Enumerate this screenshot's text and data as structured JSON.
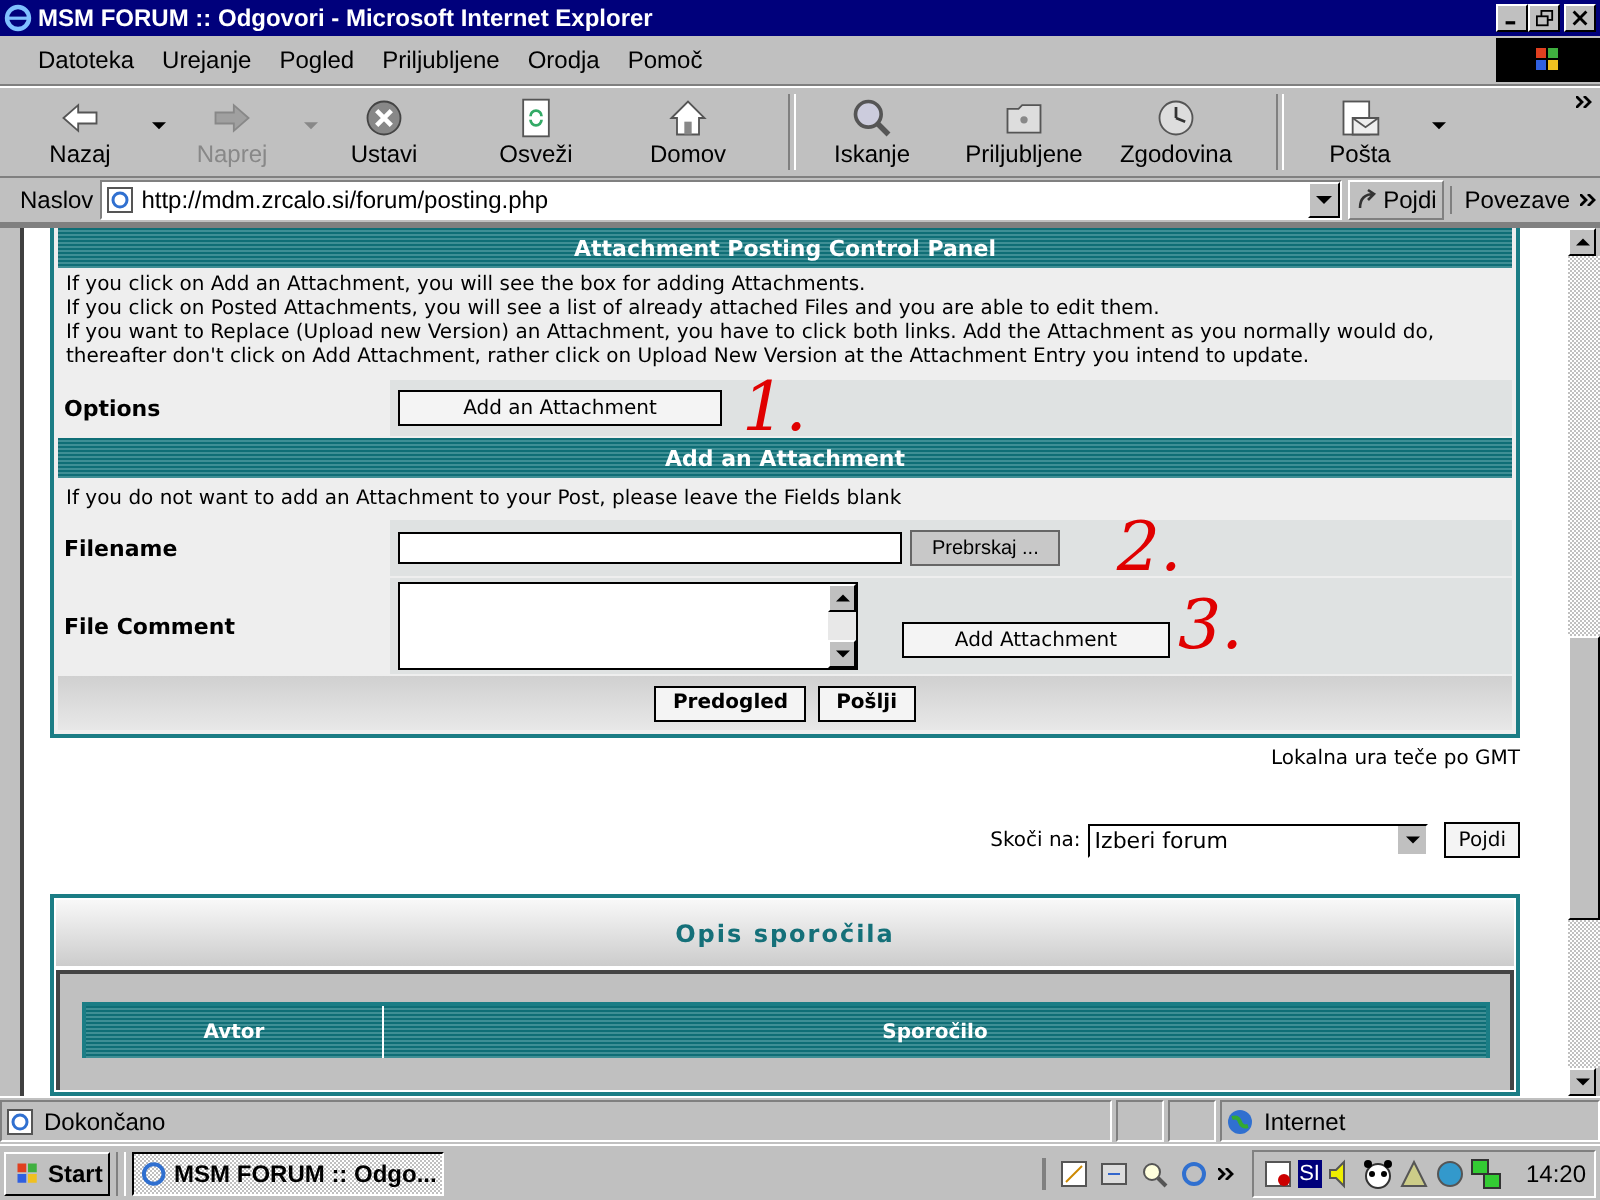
{
  "window": {
    "title": "MSM FORUM :: Odgovori - Microsoft Internet Explorer"
  },
  "menu": [
    "Datoteka",
    "Urejanje",
    "Pogled",
    "Priljubljene",
    "Orodja",
    "Pomoč"
  ],
  "toolbar": [
    {
      "label": "Nazaj",
      "kind": "back",
      "disabled": false,
      "dropdown": true,
      "separator_before": false
    },
    {
      "label": "Naprej",
      "kind": "forward",
      "disabled": true,
      "dropdown": true,
      "separator_before": false
    },
    {
      "label": "Ustavi",
      "kind": "stop",
      "disabled": false,
      "dropdown": false,
      "separator_before": false
    },
    {
      "label": "Osveži",
      "kind": "refresh",
      "disabled": false,
      "dropdown": false,
      "separator_before": false
    },
    {
      "label": "Domov",
      "kind": "home",
      "disabled": false,
      "dropdown": false,
      "separator_before": false
    },
    {
      "label": "Iskanje",
      "kind": "search",
      "disabled": false,
      "dropdown": false,
      "separator_before": true
    },
    {
      "label": "Priljubljene",
      "kind": "favorites",
      "disabled": false,
      "dropdown": false,
      "separator_before": false
    },
    {
      "label": "Zgodovina",
      "kind": "history",
      "disabled": false,
      "dropdown": false,
      "separator_before": false
    },
    {
      "label": "Pošta",
      "kind": "mail",
      "disabled": false,
      "dropdown": true,
      "separator_before": true
    }
  ],
  "address": {
    "label": "Naslov",
    "value": "http://mdm.zrcalo.si/forum/posting.php",
    "go": "Pojdi",
    "links": "Povezave"
  },
  "control_panel": {
    "title": "Attachment Posting Control Panel",
    "help": [
      "If you click on Add an Attachment, you will see the box for adding Attachments.",
      "If you click on Posted Attachments, you will see a list of already attached Files and you are able to edit them.",
      "If you want to Replace (Upload new Version) an Attachment, you have to click both links. Add the Attachment as you normally would do, thereafter don't click on Add Attachment, rather click on Upload New Version at the Attachment Entry you intend to update."
    ],
    "options_label": "Options",
    "options_button": "Add an Attachment"
  },
  "add_panel": {
    "title": "Add an Attachment",
    "note": "If you do not want to add an Attachment to your Post, please leave the Fields blank",
    "filename_label": "Filename",
    "browse_button": "Prebrskaj ...",
    "comment_label": "File Comment",
    "add_button": "Add Attachment"
  },
  "form_buttons": [
    "Predogled",
    "Pošlji"
  ],
  "annotations": [
    "1.",
    "2.",
    "3."
  ],
  "timezone": "Lokalna ura teče po GMT",
  "jump": {
    "label": "Skoči na:",
    "value": "Izberi forum",
    "button": "Pojdi"
  },
  "review_panel": {
    "title": "Opis sporočila",
    "columns": [
      "Avtor",
      "Sporočilo"
    ]
  },
  "status_bar": {
    "text": "Dokončano",
    "zone": "Internet"
  },
  "taskbar": {
    "start": "Start",
    "task": "MSM FORUM :: Odgo...",
    "language": "SI",
    "clock": "14:20"
  }
}
